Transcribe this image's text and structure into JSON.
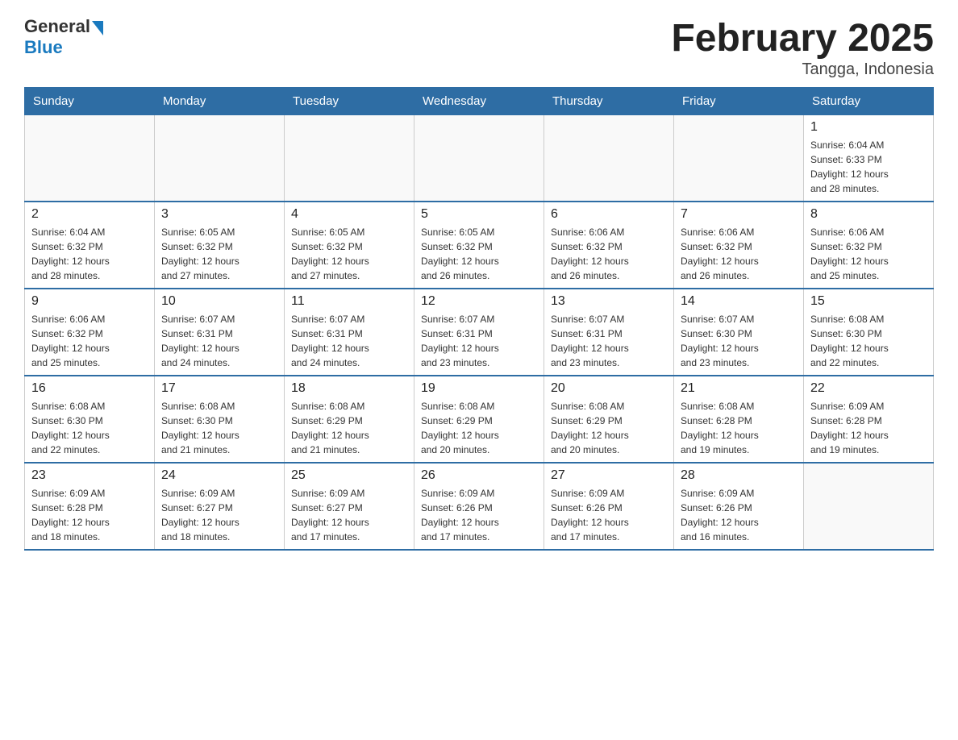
{
  "logo": {
    "general_text": "General",
    "blue_text": "Blue"
  },
  "title": "February 2025",
  "subtitle": "Tangga, Indonesia",
  "days_header": [
    "Sunday",
    "Monday",
    "Tuesday",
    "Wednesday",
    "Thursday",
    "Friday",
    "Saturday"
  ],
  "weeks": [
    [
      {
        "day": "",
        "info": ""
      },
      {
        "day": "",
        "info": ""
      },
      {
        "day": "",
        "info": ""
      },
      {
        "day": "",
        "info": ""
      },
      {
        "day": "",
        "info": ""
      },
      {
        "day": "",
        "info": ""
      },
      {
        "day": "1",
        "info": "Sunrise: 6:04 AM\nSunset: 6:33 PM\nDaylight: 12 hours\nand 28 minutes."
      }
    ],
    [
      {
        "day": "2",
        "info": "Sunrise: 6:04 AM\nSunset: 6:32 PM\nDaylight: 12 hours\nand 28 minutes."
      },
      {
        "day": "3",
        "info": "Sunrise: 6:05 AM\nSunset: 6:32 PM\nDaylight: 12 hours\nand 27 minutes."
      },
      {
        "day": "4",
        "info": "Sunrise: 6:05 AM\nSunset: 6:32 PM\nDaylight: 12 hours\nand 27 minutes."
      },
      {
        "day": "5",
        "info": "Sunrise: 6:05 AM\nSunset: 6:32 PM\nDaylight: 12 hours\nand 26 minutes."
      },
      {
        "day": "6",
        "info": "Sunrise: 6:06 AM\nSunset: 6:32 PM\nDaylight: 12 hours\nand 26 minutes."
      },
      {
        "day": "7",
        "info": "Sunrise: 6:06 AM\nSunset: 6:32 PM\nDaylight: 12 hours\nand 26 minutes."
      },
      {
        "day": "8",
        "info": "Sunrise: 6:06 AM\nSunset: 6:32 PM\nDaylight: 12 hours\nand 25 minutes."
      }
    ],
    [
      {
        "day": "9",
        "info": "Sunrise: 6:06 AM\nSunset: 6:32 PM\nDaylight: 12 hours\nand 25 minutes."
      },
      {
        "day": "10",
        "info": "Sunrise: 6:07 AM\nSunset: 6:31 PM\nDaylight: 12 hours\nand 24 minutes."
      },
      {
        "day": "11",
        "info": "Sunrise: 6:07 AM\nSunset: 6:31 PM\nDaylight: 12 hours\nand 24 minutes."
      },
      {
        "day": "12",
        "info": "Sunrise: 6:07 AM\nSunset: 6:31 PM\nDaylight: 12 hours\nand 23 minutes."
      },
      {
        "day": "13",
        "info": "Sunrise: 6:07 AM\nSunset: 6:31 PM\nDaylight: 12 hours\nand 23 minutes."
      },
      {
        "day": "14",
        "info": "Sunrise: 6:07 AM\nSunset: 6:30 PM\nDaylight: 12 hours\nand 23 minutes."
      },
      {
        "day": "15",
        "info": "Sunrise: 6:08 AM\nSunset: 6:30 PM\nDaylight: 12 hours\nand 22 minutes."
      }
    ],
    [
      {
        "day": "16",
        "info": "Sunrise: 6:08 AM\nSunset: 6:30 PM\nDaylight: 12 hours\nand 22 minutes."
      },
      {
        "day": "17",
        "info": "Sunrise: 6:08 AM\nSunset: 6:30 PM\nDaylight: 12 hours\nand 21 minutes."
      },
      {
        "day": "18",
        "info": "Sunrise: 6:08 AM\nSunset: 6:29 PM\nDaylight: 12 hours\nand 21 minutes."
      },
      {
        "day": "19",
        "info": "Sunrise: 6:08 AM\nSunset: 6:29 PM\nDaylight: 12 hours\nand 20 minutes."
      },
      {
        "day": "20",
        "info": "Sunrise: 6:08 AM\nSunset: 6:29 PM\nDaylight: 12 hours\nand 20 minutes."
      },
      {
        "day": "21",
        "info": "Sunrise: 6:08 AM\nSunset: 6:28 PM\nDaylight: 12 hours\nand 19 minutes."
      },
      {
        "day": "22",
        "info": "Sunrise: 6:09 AM\nSunset: 6:28 PM\nDaylight: 12 hours\nand 19 minutes."
      }
    ],
    [
      {
        "day": "23",
        "info": "Sunrise: 6:09 AM\nSunset: 6:28 PM\nDaylight: 12 hours\nand 18 minutes."
      },
      {
        "day": "24",
        "info": "Sunrise: 6:09 AM\nSunset: 6:27 PM\nDaylight: 12 hours\nand 18 minutes."
      },
      {
        "day": "25",
        "info": "Sunrise: 6:09 AM\nSunset: 6:27 PM\nDaylight: 12 hours\nand 17 minutes."
      },
      {
        "day": "26",
        "info": "Sunrise: 6:09 AM\nSunset: 6:26 PM\nDaylight: 12 hours\nand 17 minutes."
      },
      {
        "day": "27",
        "info": "Sunrise: 6:09 AM\nSunset: 6:26 PM\nDaylight: 12 hours\nand 17 minutes."
      },
      {
        "day": "28",
        "info": "Sunrise: 6:09 AM\nSunset: 6:26 PM\nDaylight: 12 hours\nand 16 minutes."
      },
      {
        "day": "",
        "info": ""
      }
    ]
  ]
}
